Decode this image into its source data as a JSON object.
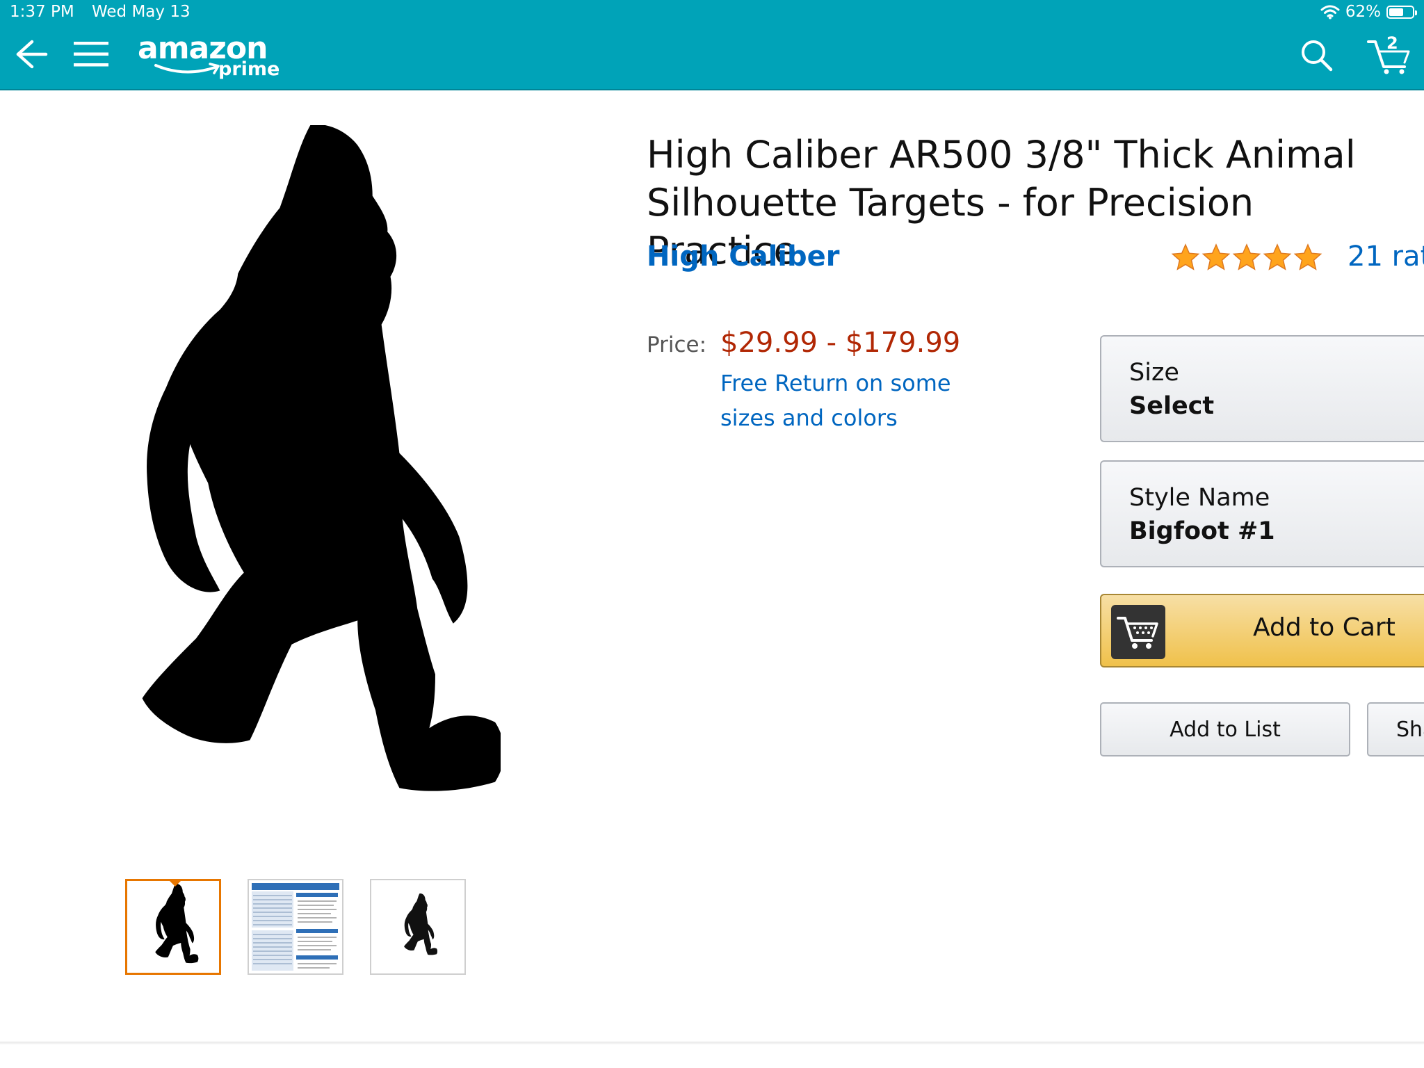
{
  "status_bar": {
    "time": "1:37 PM",
    "date": "Wed May 13",
    "battery_percent": "62%",
    "battery_level": 0.62,
    "icons": [
      "wifi-icon",
      "battery-icon"
    ]
  },
  "nav": {
    "back_icon": "back-arrow-icon",
    "menu_icon": "hamburger-menu-icon",
    "logo_word": "amazon",
    "logo_prime": "prime",
    "search_icon": "search-icon",
    "cart_icon": "cart-icon",
    "cart_count": "2"
  },
  "product": {
    "title": "High Caliber AR500 3/8\" Thick Animal Silhouette Targets - for Precision Practice",
    "brand": "High Caliber",
    "rating_stars": 5,
    "ratings_text": "21 rat",
    "price_label": "Price:",
    "price": "$29.99 - $179.99",
    "free_return": "Free Return on some sizes and colors",
    "thumbnails": [
      {
        "name": "bigfoot-target-thumbnail",
        "selected": true
      },
      {
        "name": "ar500-info-sheet-thumbnail",
        "selected": false
      },
      {
        "name": "bigfoot-small-thumbnail",
        "selected": false
      }
    ]
  },
  "buybox": {
    "size_label": "Size",
    "size_value": "Select",
    "style_label": "Style Name",
    "style_value": "Bigfoot #1",
    "add_to_cart": "Add to Cart",
    "add_to_list": "Add to List",
    "share": "Sha"
  },
  "colors": {
    "header_teal": "#00a3b8",
    "link_blue": "#0066c0",
    "price_red": "#b12704",
    "cart_button_yellow": "#f0c14b",
    "selected_thumb_orange": "#e77600",
    "star_gold": "#ffa41c"
  }
}
